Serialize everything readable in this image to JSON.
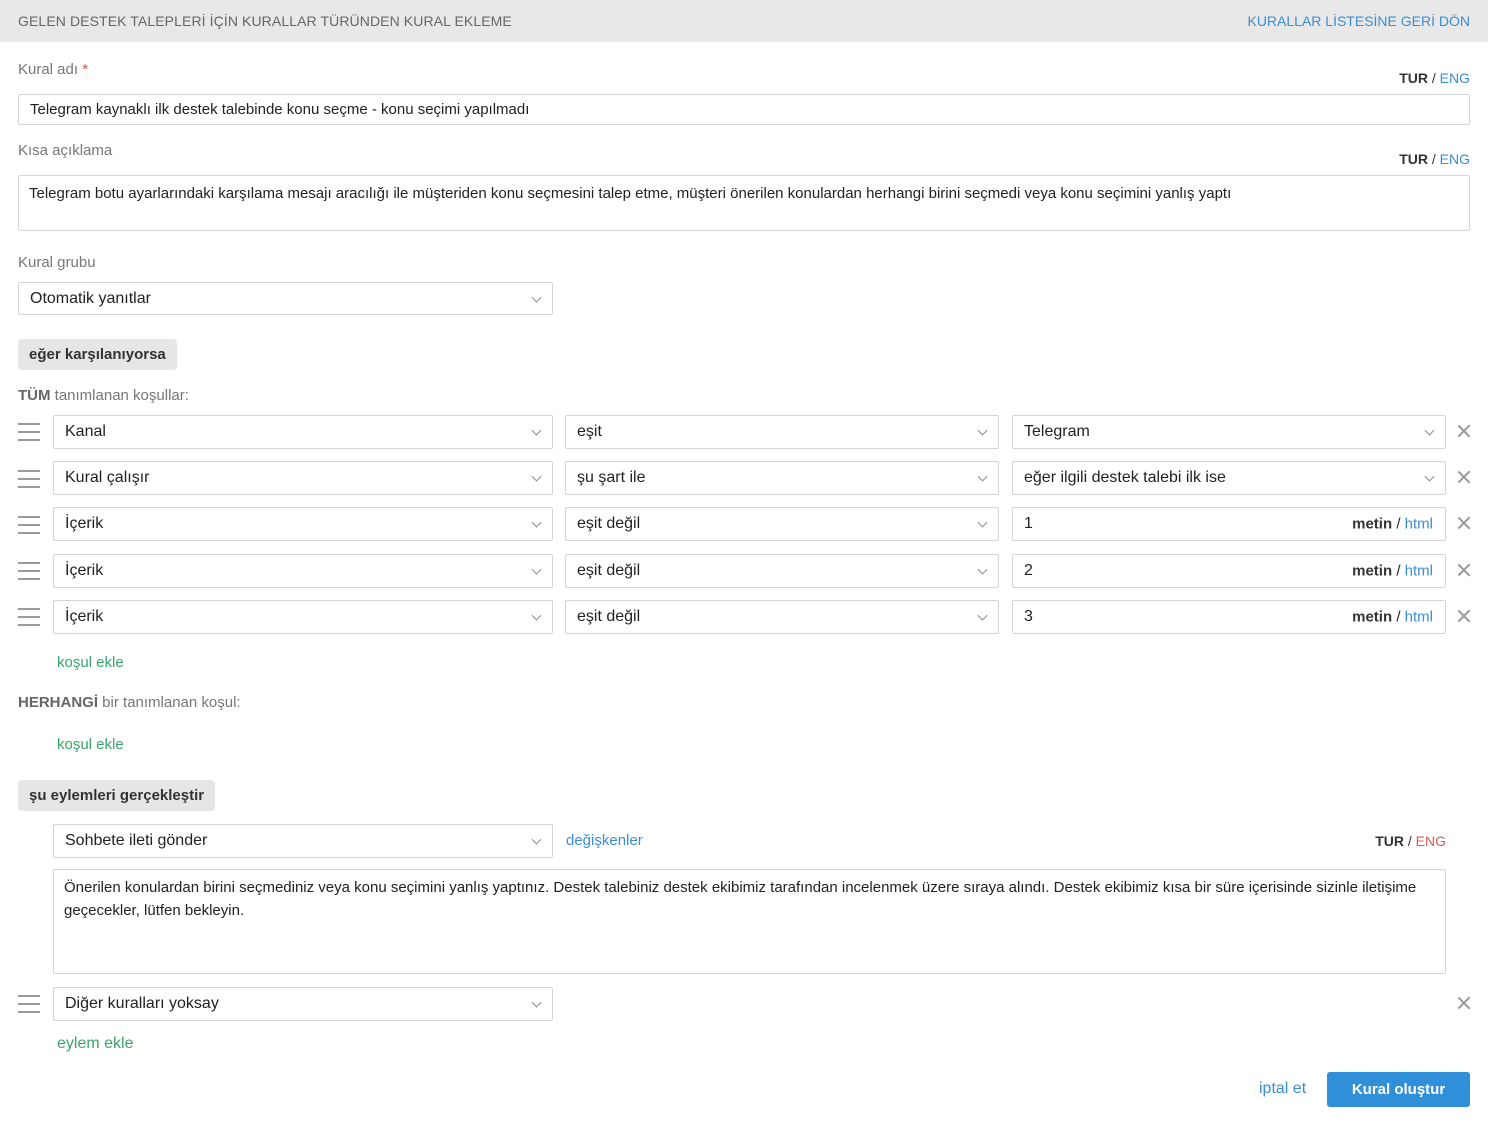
{
  "header": {
    "title": "GELEN DESTEK TALEPLERİ İÇİN KURALLAR TÜRÜNDEN KURAL EKLEME",
    "back_link": "KURALLAR LİSTESİNE GERİ DÖN"
  },
  "lang": {
    "tur": "TUR",
    "sep": "/",
    "eng": "ENG"
  },
  "form": {
    "rule_name_label": "Kural adı",
    "required_mark": "*",
    "rule_name_value": "Telegram kaynaklı ilk destek talebinde konu seçme - konu seçimi yapılmadı",
    "short_desc_label": "Kısa açıklama",
    "short_desc_value": "Telegram botu ayarlarındaki karşılama mesajı aracılığı ile müşteriden konu seçmesini talep etme, müşteri önerilen konulardan herhangi birini seçmedi veya konu seçimini yanlış yaptı",
    "group_label": "Kural grubu",
    "group_value": "Otomatik yanıtlar"
  },
  "conditions": {
    "if_pill": "eğer karşılanıyorsa",
    "all_strong": "TÜM",
    "all_rest": " tanımlanan koşullar:",
    "rows": [
      {
        "field": "Kanal",
        "op": "eşit",
        "value": "Telegram"
      },
      {
        "field": "Kural çalışır",
        "op": "şu şart ile",
        "value": "eğer ilgili destek talebi ilk ise"
      },
      {
        "field": "İçerik",
        "op": "eşit değil",
        "value": "1"
      },
      {
        "field": "İçerik",
        "op": "eşit değil",
        "value": "2"
      },
      {
        "field": "İçerik",
        "op": "eşit değil",
        "value": "3"
      }
    ],
    "mode_text": "metin",
    "mode_sep": "/",
    "mode_html": "html",
    "add_condition": "koşul ekle",
    "any_strong": "HERHANGİ",
    "any_rest": " bir tanımlanan koşul:",
    "add_condition_any": "koşul ekle"
  },
  "actions": {
    "pill": "şu eylemleri gerçekleştir",
    "action1": "Sohbete ileti gönder",
    "variables_link": "değişkenler",
    "message": "Önerilen konulardan birini seçmediniz veya konu seçimini yanlış yaptınız. Destek talebiniz destek ekibimiz tarafından incelenmek üzere sıraya alındı. Destek ekibimiz kısa bir süre içerisinde sizinle iletişime geçecekler, lütfen bekleyin.",
    "action2": "Diğer kuralları yoksay",
    "add_action": "eylem ekle"
  },
  "footer": {
    "cancel": "iptal et",
    "submit": "Kural oluştur"
  },
  "colors": {
    "accent": "#2f8fd8",
    "link": "#3a8ed4",
    "green": "#3aa56a",
    "eng_red": "#e05a5a"
  }
}
